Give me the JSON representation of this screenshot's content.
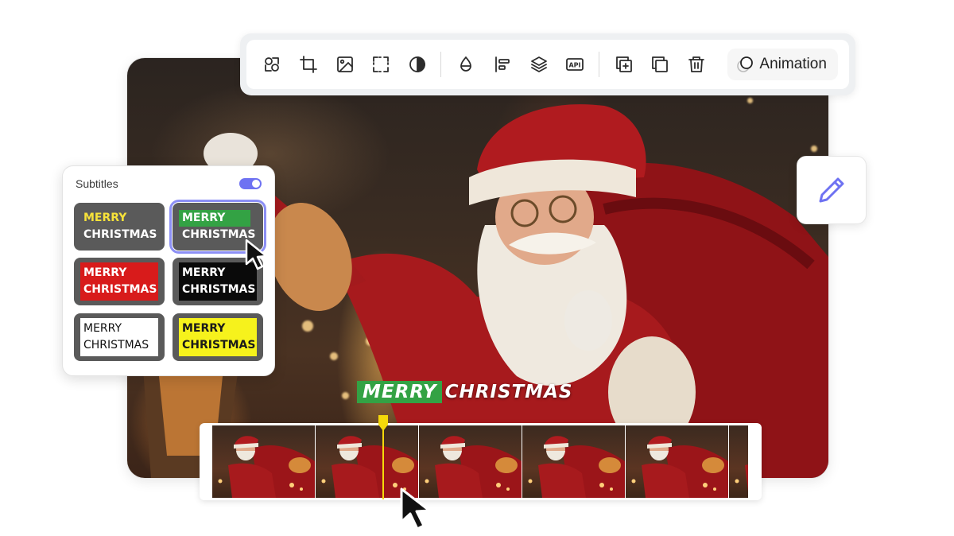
{
  "toolbar": {
    "tools": [
      {
        "name": "shapes-icon"
      },
      {
        "name": "crop-icon"
      },
      {
        "name": "image-icon"
      },
      {
        "name": "selection-frame-icon"
      },
      {
        "name": "contrast-icon"
      },
      {
        "name": "opacity-drop-icon"
      },
      {
        "name": "align-left-icon"
      },
      {
        "name": "layers-icon"
      },
      {
        "name": "api-icon",
        "label": "API"
      },
      {
        "name": "add-copy-icon"
      },
      {
        "name": "duplicate-icon"
      },
      {
        "name": "trash-icon"
      }
    ],
    "animation_label": "Animation"
  },
  "subtitles": {
    "title": "Subtitles",
    "enabled": true,
    "accent": "#6e72f2",
    "styles": [
      {
        "line1": "MERRY",
        "line2": "CHRISTMAS",
        "style": "yellow-text-gray"
      },
      {
        "line1": "MERRY",
        "line2": "CHRISTMAS",
        "style": "green-highlight-gray",
        "selected": true
      },
      {
        "line1": "MERRY",
        "line2": "CHRISTMAS",
        "style": "red-box"
      },
      {
        "line1": "MERRY",
        "line2": "CHRISTMAS",
        "style": "black-box"
      },
      {
        "line1": "MERRY",
        "line2": "CHRISTMAS",
        "style": "white-box"
      },
      {
        "line1": "MERRY",
        "line2": "CHRISTMAS",
        "style": "yellow-box"
      }
    ]
  },
  "caption": {
    "word1": "MERRY",
    "word2": "CHRISTMAS",
    "highlight_color": "#33a244"
  },
  "timeline": {
    "frame_count": 6,
    "playhead_color": "#f5d90a"
  },
  "edit_button": {
    "icon": "pencil-icon"
  }
}
